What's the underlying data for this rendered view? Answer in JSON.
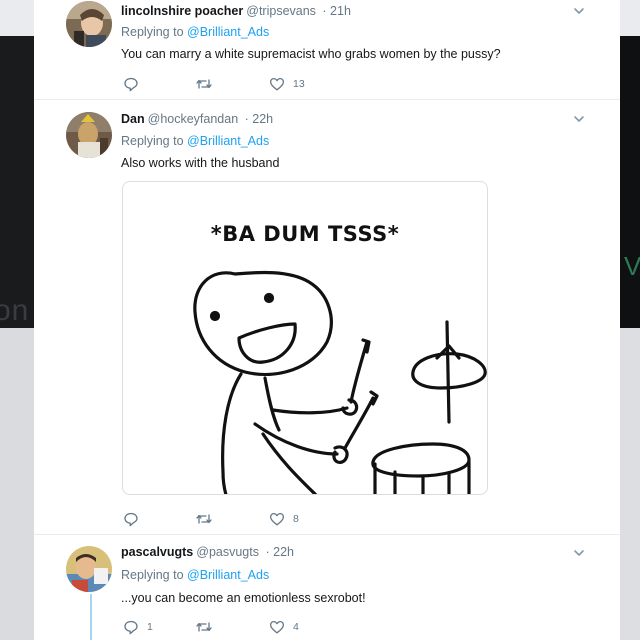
{
  "background": {
    "left_fragment": "on",
    "right_fragment": "V"
  },
  "tweets": [
    {
      "display_name": "lincolnshire poacher",
      "handle": "@tripsevans",
      "time": "· 21h",
      "reply_prefix": "Replying to",
      "reply_to": "@Brilliant_Ads",
      "text": "You can marry a white supremacist who grabs women by the pussy?",
      "reply_count": "",
      "retweet_count": "",
      "like_count": "13"
    },
    {
      "display_name": "Dan",
      "handle": "@hockeyfandan",
      "time": "· 22h",
      "reply_prefix": "Replying to",
      "reply_to": "@Brilliant_Ads",
      "text": "Also works with the husband",
      "media_caption": "*BA DUM TSSS*",
      "reply_count": "",
      "retweet_count": "",
      "like_count": "8"
    },
    {
      "display_name": "pascalvugts",
      "handle": "@pasvugts",
      "time": "· 22h",
      "reply_prefix": "Replying to",
      "reply_to": "@Brilliant_Ads",
      "text": "...you can become an emotionless sexrobot!",
      "reply_count": "1",
      "retweet_count": "",
      "like_count": "4"
    }
  ],
  "icons": {
    "reply": "reply-icon",
    "retweet": "retweet-icon",
    "like": "heart-icon",
    "more": "chevron-down-icon"
  },
  "colors": {
    "link": "#1da1f2",
    "secondary_text": "#657786",
    "thread_line": "#a6d4f2"
  }
}
